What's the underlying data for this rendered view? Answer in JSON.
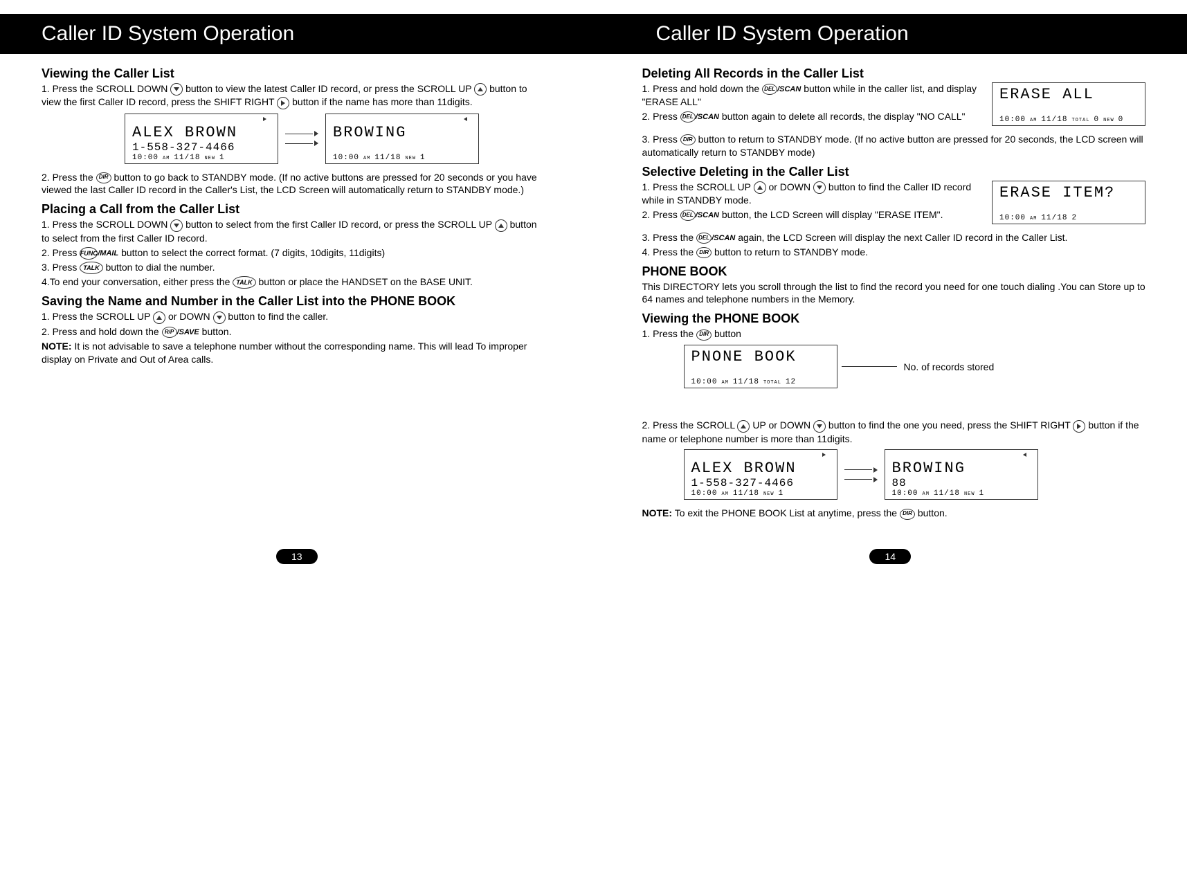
{
  "header": {
    "left_title": "Caller ID System Operation",
    "right_title": "Caller ID System Operation"
  },
  "icons": {
    "scroll_down": "▼",
    "scroll_up": "▲",
    "shift_right": "►",
    "dir": "DIR",
    "func": "FUNC",
    "mail_suffix": "/MAIL",
    "talk": "TALK",
    "rp": "R/P",
    "save_suffix": "/SAVE",
    "del": "DEL",
    "scan_suffix": "/SCAN"
  },
  "left": {
    "s1_title": "Viewing the Caller List",
    "s1_step1_a": "1. Press the SCROLL DOWN ",
    "s1_step1_b": " button to view the latest Caller ID record, or press the SCROLL UP ",
    "s1_step1_c": " button to view the first Caller ID record, press the SHIFT RIGHT ",
    "s1_step1_d": " button if the name has more than 11digits.",
    "lcd1_a_line1": "ALEX BROWN",
    "lcd1_a_line2": "1-558-327-4466",
    "lcd1_a_line3_time": "10:00",
    "lcd1_a_line3_ampm": "AM",
    "lcd1_a_line3_date": "11/18",
    "lcd1_a_line3_new": "NEW",
    "lcd1_a_line3_count": "1",
    "lcd1_b_line1": "BROWING",
    "lcd1_b_line3_time": "10:00",
    "lcd1_b_line3_ampm": "AM",
    "lcd1_b_line3_date": "11/18",
    "lcd1_b_line3_new": "NEW",
    "lcd1_b_line3_count": "1",
    "s1_step2_a": "2. Press the ",
    "s1_step2_b": " button to  go back to STANDBY mode. (If no active buttons  are pressed for 20 seconds or you have viewed the last Caller ID record in the Caller's List, the LCD Screen will automatically return to STANDBY mode.)",
    "s2_title": "Placing a Call from the Caller List",
    "s2_step1_a": "1. Press the SCROLL DOWN ",
    "s2_step1_b": " button to select from the first Caller ID record, or press  the SCROLL UP ",
    "s2_step1_c": " button to select from the first Caller ID record.",
    "s2_step2_a": "2. Press ",
    "s2_step2_b": " button to select the correct format. (7 digits, 10digits, 11digits)",
    "s2_step3_a": "3. Press  ",
    "s2_step3_b": "  button to dial the number.",
    "s2_step4_a": "4.To end your conversation, either press the ",
    "s2_step4_b": " button or place the HANDSET on the BASE UNIT.",
    "s3_title": "Saving the Name and Number in the Caller List into the PHONE BOOK",
    "s3_step1_a": "1.  Press the SCROLL UP ",
    "s3_step1_b": " or DOWN ",
    "s3_step1_c": " button to find the caller.",
    "s3_step2_a": "2.  Press and hold down the  ",
    "s3_step2_b": " button.",
    "s3_note_label": "NOTE:",
    "s3_note_text": " It is not advisable to save a telephone number without the corresponding name. This will lead To improper display on Private  and Out of Area calls."
  },
  "right": {
    "s4_title": "Deleting All Records in the Caller List",
    "s4_step1_a": "1. Press and hold down the ",
    "s4_step1_b": " button while in the caller list, and display \"ERASE ALL\"",
    "lcd_erase_all_line1": "ERASE ALL",
    "lcd_erase_all_time": "10:00",
    "lcd_erase_all_ampm": "AM",
    "lcd_erase_all_date": "11/18",
    "lcd_erase_all_tot": "TOTAL",
    "lcd_erase_all_t": "0",
    "lcd_erase_all_new": "NEW",
    "lcd_erase_all_n": "0",
    "s4_step2_a": "2. Press  ",
    "s4_step2_b": " button again to delete all records, the display \"NO CALL\"",
    "s4_step3_a": "3. Press  ",
    "s4_step3_b": " button to return to STANDBY mode. (If no active button are pressed for 20  seconds, the LCD screen will automatically return to STANDBY mode)",
    "s5_title": "Selective Deleting in the Caller List",
    "s5_step1_a": "1. Press the SCROLL UP  ",
    "s5_step1_b": " or DOWN  ",
    "s5_step1_c": "  button to find the Caller ID record while in STANDBY mode.",
    "lcd_erase_item_line1": "ERASE ITEM?",
    "lcd_erase_item_time": "10:00",
    "lcd_erase_item_ampm": "AM",
    "lcd_erase_item_date": "11/18",
    "lcd_erase_item_count": "2",
    "s5_step2_a": "2. Press",
    "s5_step2_b": " button,  the LCD Screen will display   \"ERASE ITEM\".",
    "s5_step3_a": "3. Press the  ",
    "s5_step3_b": " again, the LCD Screen will display the next Caller ID record in the Caller List.",
    "s5_step4_a": "4. Press the ",
    "s5_step4_b": " button to return to STANDBY mode.",
    "s6_title": "PHONE BOOK",
    "s6_text": "This DIRECTORY lets you scroll through the list to find the record you need for one  touch dialing .You can Store up to 64 names and telephone numbers in the Memory.",
    "s7_title": "Viewing the PHONE BOOK",
    "s7_step1_a": "1. Press the ",
    "s7_step1_b": " button",
    "lcd_pb_line1": "PNONE BOOK",
    "lcd_pb_time": "10:00",
    "lcd_pb_ampm": "AM",
    "lcd_pb_date": "11/18",
    "lcd_pb_tot": "TOTAL",
    "lcd_pb_count": "12",
    "annot_records": "No. of records stored",
    "s7_step2_a": "2. Press the SCROLL ",
    "s7_step2_b": " UP or DOWN  ",
    "s7_step2_c": "  button to find the one you need, press the SHIFT RIGHT",
    "s7_step2_d": " button if the name or telephone number is more than 11digits.",
    "lcd2_a_line1": "ALEX BROWN",
    "lcd2_a_line2": "1-558-327-4466",
    "lcd2_a_time": "10:00",
    "lcd2_a_ampm": "AM",
    "lcd2_a_date": "11/18",
    "lcd2_a_new": "NEW",
    "lcd2_a_count": "1",
    "lcd2_b_line1": "BROWING",
    "lcd2_b_line2": "88",
    "lcd2_b_time": "10:00",
    "lcd2_b_ampm": "AM",
    "lcd2_b_date": "11/18",
    "lcd2_b_new": "NEW",
    "lcd2_b_count": "1",
    "s7_note_label": "NOTE:",
    "s7_note_text": " To exit the PHONE BOOK List at anytime, press the ",
    "s7_note_text2": " button."
  },
  "pages": {
    "left": "13",
    "right": "14"
  }
}
